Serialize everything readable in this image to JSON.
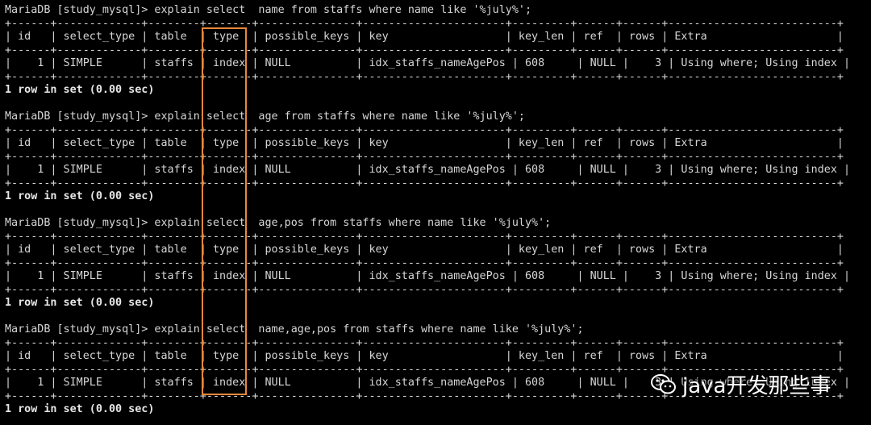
{
  "terminal": {
    "lines": [
      {
        "text": "MariaDB [study_mysql]> explain select  name from staffs where name like '%july%';",
        "bold": false
      },
      {
        "text": "+------+-------------+--------+-------+---------------+----------------------+---------+------+------+--------------------------+",
        "bold": false
      },
      {
        "text": "| id   | select_type | table  | type  | possible_keys | key                  | key_len | ref  | rows | Extra                    |",
        "bold": false
      },
      {
        "text": "+------+-------------+--------+-------+---------------+----------------------+---------+------+------+--------------------------+",
        "bold": false
      },
      {
        "text": "|    1 | SIMPLE      | staffs | index | NULL          | idx_staffs_nameAgePos | 608     | NULL |    3 | Using where; Using index |",
        "bold": false
      },
      {
        "text": "+------+-------------+--------+-------+---------------+----------------------+---------+------+------+--------------------------+",
        "bold": false
      },
      {
        "text": "1 row in set (0.00 sec)",
        "bold": true
      },
      {
        "text": "",
        "bold": false
      },
      {
        "text": "MariaDB [study_mysql]> explain select  age from staffs where name like '%july%';",
        "bold": false
      },
      {
        "text": "+------+-------------+--------+-------+---------------+----------------------+---------+------+------+--------------------------+",
        "bold": false
      },
      {
        "text": "| id   | select_type | table  | type  | possible_keys | key                  | key_len | ref  | rows | Extra                    |",
        "bold": false
      },
      {
        "text": "+------+-------------+--------+-------+---------------+----------------------+---------+------+------+--------------------------+",
        "bold": false
      },
      {
        "text": "|    1 | SIMPLE      | staffs | index | NULL          | idx_staffs_nameAgePos | 608     | NULL |    3 | Using where; Using index |",
        "bold": false
      },
      {
        "text": "+------+-------------+--------+-------+---------------+----------------------+---------+------+------+--------------------------+",
        "bold": false
      },
      {
        "text": "1 row in set (0.00 sec)",
        "bold": true
      },
      {
        "text": "",
        "bold": false
      },
      {
        "text": "MariaDB [study_mysql]> explain select  age,pos from staffs where name like '%july%';",
        "bold": false
      },
      {
        "text": "+------+-------------+--------+-------+---------------+----------------------+---------+------+------+--------------------------+",
        "bold": false
      },
      {
        "text": "| id   | select_type | table  | type  | possible_keys | key                  | key_len | ref  | rows | Extra                    |",
        "bold": false
      },
      {
        "text": "+------+-------------+--------+-------+---------------+----------------------+---------+------+------+--------------------------+",
        "bold": false
      },
      {
        "text": "|    1 | SIMPLE      | staffs | index | NULL          | idx_staffs_nameAgePos | 608     | NULL |    3 | Using where; Using index |",
        "bold": false
      },
      {
        "text": "+------+-------------+--------+-------+---------------+----------------------+---------+------+------+--------------------------+",
        "bold": false
      },
      {
        "text": "1 row in set (0.00 sec)",
        "bold": true
      },
      {
        "text": "",
        "bold": false
      },
      {
        "text": "MariaDB [study_mysql]> explain select  name,age,pos from staffs where name like '%july%';",
        "bold": false
      },
      {
        "text": "+------+-------------+--------+-------+---------------+----------------------+---------+------+------+--------------------------+",
        "bold": false
      },
      {
        "text": "| id   | select_type | table  | type  | possible_keys | key                  | key_len | ref  | rows | Extra                    |",
        "bold": false
      },
      {
        "text": "+------+-------------+--------+-------+---------------+----------------------+---------+------+------+--------------------------+",
        "bold": false
      },
      {
        "text": "|    1 | SIMPLE      | staffs | index | NULL          | idx_staffs_nameAgePos | 608     | NULL |    3 | Using where; Using index |",
        "bold": false
      },
      {
        "text": "+------+-------------+--------+-------+---------------+----------------------+---------+------+------+--------------------------+",
        "bold": false
      },
      {
        "text": "1 row in set (0.00 sec)",
        "bold": true
      }
    ]
  },
  "highlight": {
    "color": "#e8883a",
    "icon": "highlight-box"
  },
  "watermark": {
    "text": "java开发那些事",
    "icon": "wechat-icon"
  }
}
